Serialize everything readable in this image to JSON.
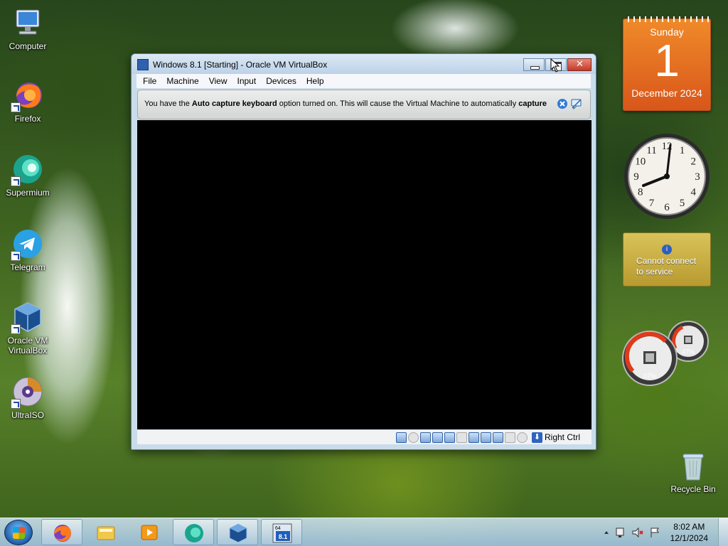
{
  "desktop": {
    "icons": [
      {
        "label": "Computer",
        "icon": "computer-icon"
      },
      {
        "label": "Firefox",
        "icon": "firefox-icon"
      },
      {
        "label": "Supermium",
        "icon": "supermium-icon"
      },
      {
        "label": "Telegram",
        "icon": "telegram-icon"
      },
      {
        "label": "Oracle VM VirtualBox",
        "label_line1": "Oracle VM",
        "label_line2": "VirtualBox",
        "icon": "virtualbox-icon"
      },
      {
        "label": "UltraISO",
        "icon": "ultraiso-icon"
      },
      {
        "label": "Recycle Bin",
        "icon": "recycle-bin-icon"
      }
    ]
  },
  "gadgets": {
    "calendar": {
      "weekday": "Sunday",
      "day": "1",
      "month_year": "December 2024"
    },
    "clock": {
      "numerals": [
        "12",
        "1",
        "2",
        "3",
        "4",
        "5",
        "6",
        "7",
        "8",
        "9",
        "10",
        "11"
      ]
    },
    "weather": {
      "message_line1": "Cannot connect",
      "message_line2": "to service"
    },
    "meters": {
      "cpu": "07%",
      "memory": "47%"
    }
  },
  "window": {
    "title": "Windows 8.1 [Starting] - Oracle VM VirtualBox",
    "menu": [
      "File",
      "Machine",
      "View",
      "Input",
      "Devices",
      "Help"
    ],
    "notice": {
      "part1": "You have the ",
      "bold1": "Auto capture keyboard",
      "part2": " option turned on. This will cause the Virtual Machine to automatically ",
      "bold2": "capture"
    },
    "status": {
      "host_key": "Right Ctrl"
    }
  },
  "taskbar": {
    "vm_badge": "64",
    "vm_version": "8.1",
    "time": "8:02 AM",
    "date": "12/1/2024"
  },
  "colors": {
    "calendar": "#e8711f",
    "window_frame": "#c9dceb",
    "vm_screen": "#000000",
    "taskbar": "#b9d3ea"
  }
}
